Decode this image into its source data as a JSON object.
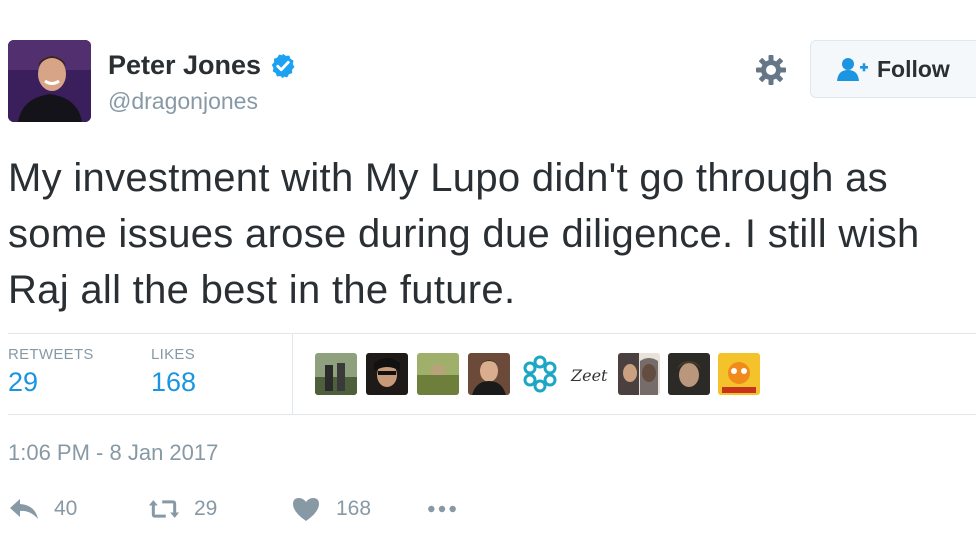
{
  "author": {
    "name": "Peter Jones",
    "handle": "@dragonjones",
    "verified": true
  },
  "header": {
    "follow_label": "Follow"
  },
  "tweet": {
    "text": "My investment with My Lupo didn't go through as some issues arose during due diligence. I still wish Raj all the best in the future.",
    "timestamp": "1:06 PM - 8 Jan 2017"
  },
  "stats": {
    "retweets_label": "RETWEETS",
    "retweets_count": "29",
    "likes_label": "LIKES",
    "likes_count": "168"
  },
  "liker_avatars": [
    {
      "name": "avatar-1",
      "color": "#6a7c5e"
    },
    {
      "name": "avatar-2",
      "color": "#2d2623"
    },
    {
      "name": "avatar-3",
      "color": "#7b8a4d"
    },
    {
      "name": "avatar-4",
      "color": "#5a3a2a"
    },
    {
      "name": "avatar-5",
      "color": "#1aa6c4"
    },
    {
      "name": "avatar-6",
      "color": "#ffffff",
      "logo_text": "Zeet"
    },
    {
      "name": "avatar-7",
      "color": "#3b3434"
    },
    {
      "name": "avatar-8",
      "color": "#2b2a26"
    },
    {
      "name": "avatar-9",
      "color": "#f4c22a"
    }
  ],
  "actions": {
    "reply_count": "40",
    "retweet_count": "29",
    "like_count": "168"
  },
  "colors": {
    "accent": "#1b95e0",
    "muted": "#8899a6",
    "text": "#292f33",
    "border": "#e1e8ed"
  }
}
